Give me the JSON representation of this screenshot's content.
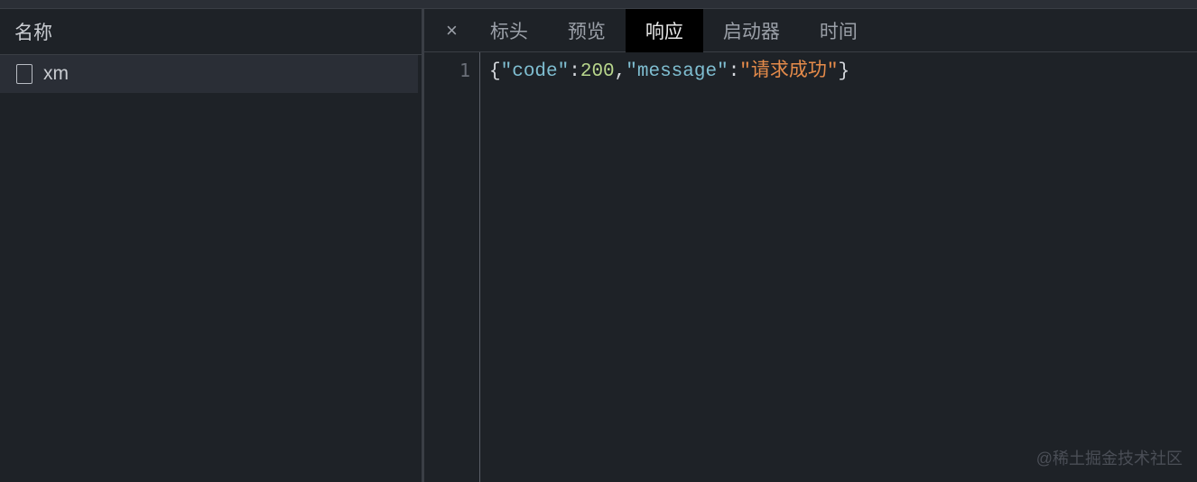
{
  "sidebar": {
    "header": "名称",
    "items": [
      {
        "name": "xm"
      }
    ]
  },
  "tabs": {
    "close": "×",
    "items": [
      {
        "label": "标头",
        "active": false
      },
      {
        "label": "预览",
        "active": false
      },
      {
        "label": "响应",
        "active": true
      },
      {
        "label": "启动器",
        "active": false
      },
      {
        "label": "时间",
        "active": false
      }
    ]
  },
  "response": {
    "line_number": "1",
    "json": {
      "code_key": "\"code\"",
      "code_val": "200",
      "message_key": "\"message\"",
      "message_val": "\"请求成功\""
    }
  },
  "watermark": "@稀土掘金技术社区"
}
